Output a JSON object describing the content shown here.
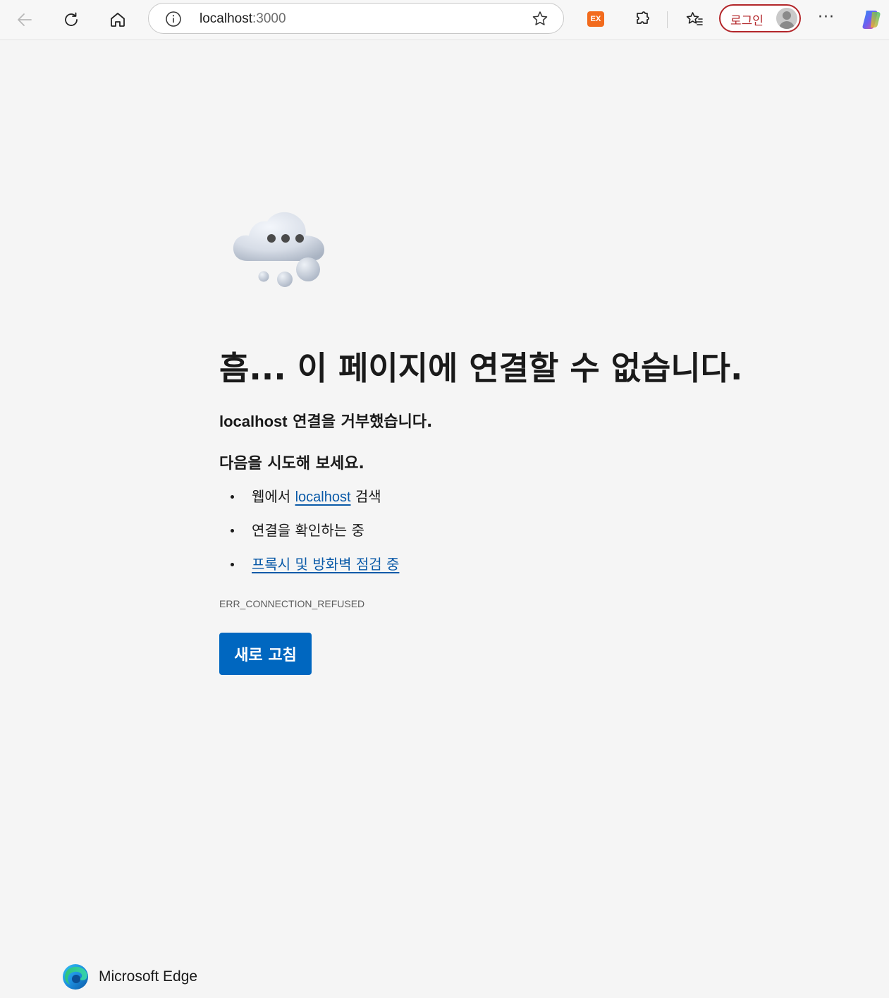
{
  "browser": {
    "address_bar": {
      "host": "localhost",
      "port": ":3000"
    },
    "extension_badge": "EX",
    "login_label": "로그인",
    "more_label": "···"
  },
  "error_page": {
    "title": "흠... 이 페이지에 연결할 수 없습니다.",
    "subtitle_host": "localhost",
    "subtitle_rest": " 연결을 거부했습니다.",
    "try_heading": "다음을 시도해 보세요.",
    "suggestions": {
      "search": {
        "prefix": "웹에서 ",
        "link": "localhost",
        "suffix": " 검색"
      },
      "check_connection": "연결을 확인하는 중",
      "proxy_firewall": "프록시 및 방화벽 점검 중"
    },
    "error_code": "ERR_CONNECTION_REFUSED",
    "reload_button": "새로 고침"
  },
  "footer": {
    "brand": "Microsoft Edge"
  },
  "colors": {
    "accent": "#0067c0",
    "link": "#0a5aa8",
    "login_border": "#b3262a",
    "page_bg": "#f5f5f5"
  },
  "icons": [
    "back-arrow-icon",
    "refresh-icon",
    "home-icon",
    "info-icon",
    "favorite-star-icon",
    "extensions-icon",
    "favorites-icon",
    "avatar-icon",
    "more-icon",
    "copilot-icon",
    "cloud-icon",
    "edge-logo-icon"
  ]
}
